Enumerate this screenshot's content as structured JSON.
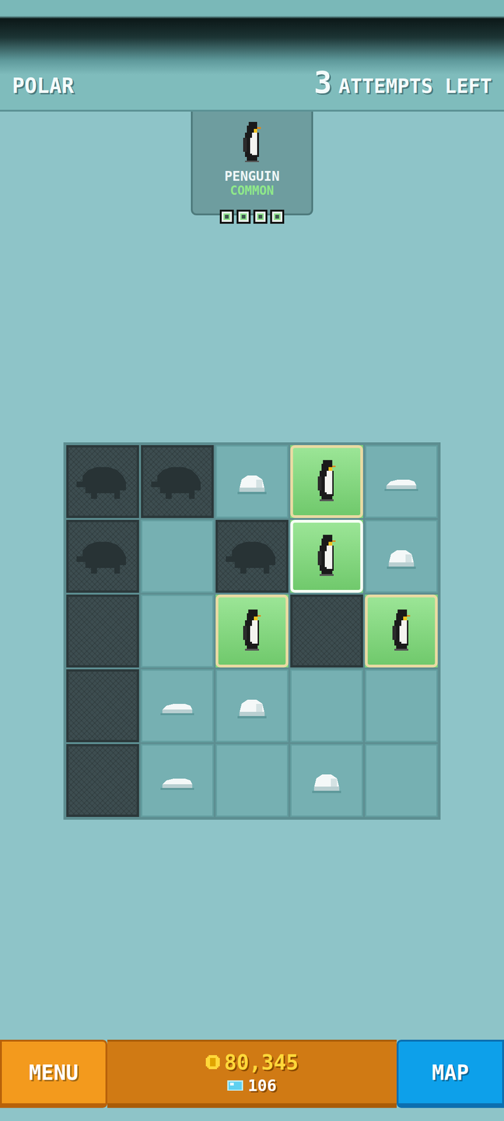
{
  "header": {
    "region": "POLAR",
    "attempts": "3",
    "attempts_label": "ATTEMPTS LEFT"
  },
  "target": {
    "name": "PENGUIN",
    "rarity": "COMMON",
    "progress": [
      {
        "filled": true
      },
      {
        "filled": true
      },
      {
        "filled": true
      },
      {
        "filled": true
      }
    ]
  },
  "grid": {
    "rows": [
      [
        {
          "kind": "shadow",
          "selected": false
        },
        {
          "kind": "shadow",
          "selected": false
        },
        {
          "kind": "ice",
          "decor": "mound",
          "selected": false
        },
        {
          "kind": "penguin",
          "selected": false
        },
        {
          "kind": "ice",
          "decor": "drift",
          "selected": false
        }
      ],
      [
        {
          "kind": "shadow",
          "selected": false
        },
        {
          "kind": "ice",
          "decor": "none",
          "selected": false
        },
        {
          "kind": "shadow",
          "selected": false
        },
        {
          "kind": "penguin",
          "selected": true
        },
        {
          "kind": "ice",
          "decor": "mound",
          "selected": false
        }
      ],
      [
        {
          "kind": "hidden",
          "selected": false
        },
        {
          "kind": "ice",
          "decor": "none",
          "selected": false
        },
        {
          "kind": "penguin",
          "selected": false
        },
        {
          "kind": "hidden",
          "selected": false
        },
        {
          "kind": "penguin",
          "selected": false
        }
      ],
      [
        {
          "kind": "hidden",
          "selected": false
        },
        {
          "kind": "ice",
          "decor": "drift",
          "selected": false
        },
        {
          "kind": "ice",
          "decor": "mound",
          "selected": false
        },
        {
          "kind": "ice",
          "decor": "none",
          "selected": false
        },
        {
          "kind": "ice",
          "decor": "none",
          "selected": false
        }
      ],
      [
        {
          "kind": "hidden",
          "selected": false
        },
        {
          "kind": "ice",
          "decor": "drift",
          "selected": false
        },
        {
          "kind": "ice",
          "decor": "none",
          "selected": false
        },
        {
          "kind": "ice",
          "decor": "mound",
          "selected": false
        },
        {
          "kind": "ice",
          "decor": "none",
          "selected": false
        }
      ]
    ]
  },
  "footer": {
    "menu": "MENU",
    "coins": "80,345",
    "gems": "106",
    "map": "MAP"
  }
}
